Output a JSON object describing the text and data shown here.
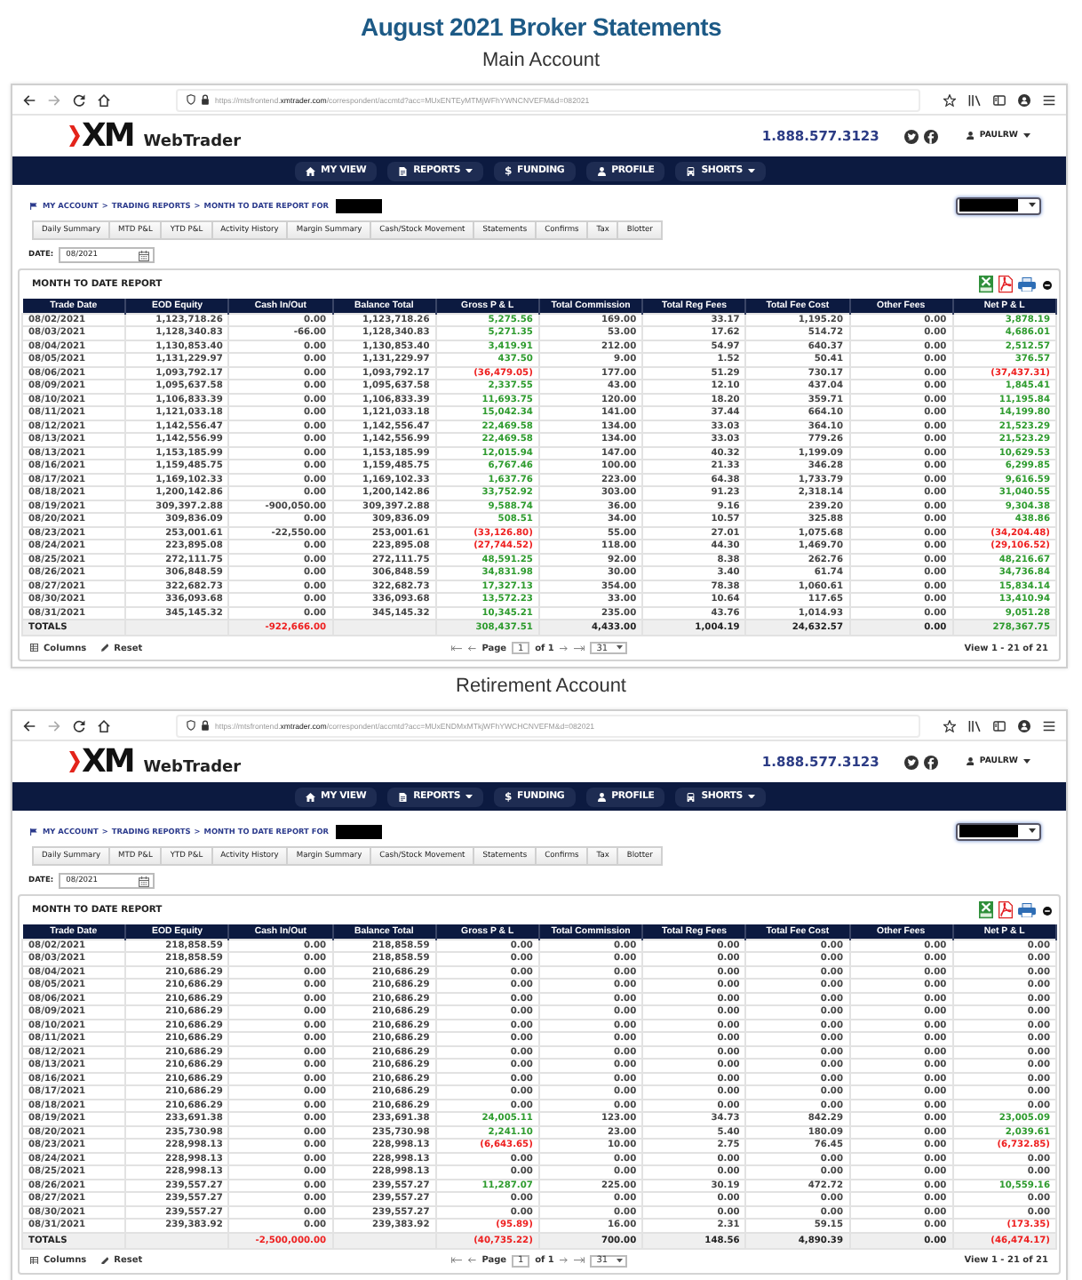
{
  "title": "August 2021 Broker Statements",
  "accounts": [
    {
      "heading": "Main Account",
      "browser": {
        "url": {
          "prefix": "https://mtsfrontend.",
          "domain": "xmtrader.com",
          "path": "/correspondent/accmtd?acc=MUxENTEyMTMjWFhYWNCNVEFM&d=082021"
        }
      },
      "header": {
        "logo": "XM",
        "product": "WebTrader",
        "phone": "1.888.577.3123",
        "user": "PAULRW"
      },
      "nav": [
        {
          "label": "MY VIEW",
          "dropdown": false
        },
        {
          "label": "REPORTS",
          "dropdown": true
        },
        {
          "label": "FUNDING",
          "glyph": "$",
          "dropdown": false
        },
        {
          "label": "PROFILE",
          "dropdown": false
        },
        {
          "label": "SHORTS",
          "dropdown": true
        }
      ],
      "breadcrumb": [
        {
          "label": "MY ACCOUNT",
          "separator": ">"
        },
        {
          "label": "TRADING REPORTS",
          "separator": ">"
        },
        {
          "label": "MONTH TO DATE REPORT FOR"
        }
      ],
      "tabs": [
        "Daily Summary",
        "MTD P&L",
        "YTD P&L",
        "Activity History",
        "Margin Summary",
        "Cash/Stock Movement",
        "Statements",
        "Confirms",
        "Tax",
        "Blotter"
      ],
      "date": {
        "label": "DATE:",
        "value": "08/2021"
      },
      "report": {
        "title": "MONTH TO DATE REPORT",
        "table": {
          "columns": [
            {
              "label": "Trade Date",
              "kind": "date"
            },
            {
              "label": "EOD Equity",
              "kind": "amount"
            },
            {
              "label": "Cash In/Out",
              "kind": "amount"
            },
            {
              "label": "Balance Total",
              "kind": "amount"
            },
            {
              "label": "Gross P & L",
              "kind": "pl"
            },
            {
              "label": "Total Commission",
              "kind": "amount"
            },
            {
              "label": "Total Reg Fees",
              "kind": "amount"
            },
            {
              "label": "Total Fee Cost",
              "kind": "amount"
            },
            {
              "label": "Other Fees",
              "kind": "amount"
            },
            {
              "label": "Net P & L",
              "kind": "pl"
            }
          ],
          "rows": [
            {
              "cells": [
                "08/02/2021",
                "1,123,718.26",
                "0.00",
                "1,123,718.26",
                "5,275.56",
                "169.00",
                "33.17",
                "1,195.20",
                "0.00",
                "3,878.19"
              ],
              "color": "#2e9b2e"
            },
            {
              "cells": [
                "08/03/2021",
                "1,128,340.83",
                "-66.00",
                "1,128,340.83",
                "5,271.35",
                "53.00",
                "17.62",
                "514.72",
                "0.00",
                "4,686.01"
              ],
              "color": "#2e9b2e"
            },
            {
              "cells": [
                "08/04/2021",
                "1,130,853.40",
                "0.00",
                "1,130,853.40",
                "3,419.91",
                "212.00",
                "54.97",
                "640.37",
                "0.00",
                "2,512.57"
              ],
              "color": "#2e9b2e"
            },
            {
              "cells": [
                "08/05/2021",
                "1,131,229.97",
                "0.00",
                "1,131,229.97",
                "437.50",
                "9.00",
                "1.52",
                "50.41",
                "0.00",
                "376.57"
              ],
              "color": "#2e9b2e"
            },
            {
              "cells": [
                "08/06/2021",
                "1,093,792.17",
                "0.00",
                "1,093,792.17",
                "(36,479.05)",
                "177.00",
                "51.29",
                "730.17",
                "0.00",
                "(37,437.31)"
              ],
              "color": "#ee2020"
            },
            {
              "cells": [
                "08/09/2021",
                "1,095,637.58",
                "0.00",
                "1,095,637.58",
                "2,337.55",
                "43.00",
                "12.10",
                "437.04",
                "0.00",
                "1,845.41"
              ],
              "color": "#2e9b2e"
            },
            {
              "cells": [
                "08/10/2021",
                "1,106,833.39",
                "0.00",
                "1,106,833.39",
                "11,693.75",
                "120.00",
                "18.20",
                "359.71",
                "0.00",
                "11,195.84"
              ],
              "color": "#2e9b2e"
            },
            {
              "cells": [
                "08/11/2021",
                "1,121,033.18",
                "0.00",
                "1,121,033.18",
                "15,042.34",
                "141.00",
                "37.44",
                "664.10",
                "0.00",
                "14,199.80"
              ],
              "color": "#2e9b2e"
            },
            {
              "cells": [
                "08/12/2021",
                "1,142,556.47",
                "0.00",
                "1,142,556.47",
                "22,469.58",
                "134.00",
                "33.03",
                "364.10",
                "0.00",
                "21,523.29"
              ],
              "color": "#2e9b2e"
            },
            {
              "cells": [
                "08/13/2021",
                "1,142,556.99",
                "0.00",
                "1,142,556.99",
                "22,469.58",
                "134.00",
                "33.03",
                "779.26",
                "0.00",
                "21,523.29"
              ],
              "color": "#2e9b2e"
            },
            {
              "cells": [
                "08/13/2021",
                "1,153,185.99",
                "0.00",
                "1,153,185.99",
                "12,015.94",
                "147.00",
                "40.32",
                "1,199.09",
                "0.00",
                "10,629.53"
              ],
              "color": "#2e9b2e"
            },
            {
              "cells": [
                "08/16/2021",
                "1,159,485.75",
                "0.00",
                "1,159,485.75",
                "6,767.46",
                "100.00",
                "21.33",
                "346.28",
                "0.00",
                "6,299.85"
              ],
              "color": "#2e9b2e"
            },
            {
              "cells": [
                "08/17/2021",
                "1,169,102.33",
                "0.00",
                "1,169,102.33",
                "1,637.76",
                "223.00",
                "64.38",
                "1,733.79",
                "0.00",
                "9,616.59"
              ],
              "color": "#2e9b2e"
            },
            {
              "cells": [
                "08/18/2021",
                "1,200,142.86",
                "0.00",
                "1,200,142.86",
                "33,752.92",
                "303.00",
                "91.23",
                "2,318.14",
                "0.00",
                "31,040.55"
              ],
              "color": "#2e9b2e"
            },
            {
              "cells": [
                "08/19/2021",
                "309,397.2.88",
                "-900,050.00",
                "309,397.2.88",
                "9,588.74",
                "36.00",
                "9.16",
                "239.20",
                "0.00",
                "9,304.38"
              ],
              "color": "#2e9b2e"
            },
            {
              "cells": [
                "08/20/2021",
                "309,836.09",
                "0.00",
                "309,836.09",
                "508.51",
                "34.00",
                "10.57",
                "325.88",
                "0.00",
                "438.86"
              ],
              "color": "#2e9b2e"
            },
            {
              "cells": [
                "08/23/2021",
                "253,001.61",
                "-22,550.00",
                "253,001.61",
                "(33,126.80)",
                "55.00",
                "27.01",
                "1,075.68",
                "0.00",
                "(34,204.48)"
              ],
              "color": "#ee2020"
            },
            {
              "cells": [
                "08/24/2021",
                "223,895.08",
                "0.00",
                "223,895.08",
                "(27,744.52)",
                "118.00",
                "44.30",
                "1,469.70",
                "0.00",
                "(29,106.52)"
              ],
              "color": "#ee2020"
            },
            {
              "cells": [
                "08/25/2021",
                "272,111.75",
                "0.00",
                "272,111.75",
                "48,591.25",
                "92.00",
                "8.38",
                "262.76",
                "0.00",
                "48,216.67"
              ],
              "color": "#2e9b2e"
            },
            {
              "cells": [
                "08/26/2021",
                "306,848.59",
                "0.00",
                "306,848.59",
                "34,831.98",
                "30.00",
                "3.40",
                "61.74",
                "0.00",
                "34,736.84"
              ],
              "color": "#2e9b2e"
            },
            {
              "cells": [
                "08/27/2021",
                "322,682.73",
                "0.00",
                "322,682.73",
                "17,327.13",
                "354.00",
                "78.38",
                "1,060.61",
                "0.00",
                "15,834.14"
              ],
              "color": "#2e9b2e"
            },
            {
              "cells": [
                "08/30/2021",
                "336,093.68",
                "0.00",
                "336,093.68",
                "13,572.23",
                "33.00",
                "10.64",
                "117.65",
                "0.00",
                "13,410.94"
              ],
              "color": "#2e9b2e"
            },
            {
              "cells": [
                "08/31/2021",
                "345,145.32",
                "0.00",
                "345,145.32",
                "10,345.21",
                "235.00",
                "43.76",
                "1,014.93",
                "0.00",
                "9,051.28"
              ],
              "color": "#2e9b2e"
            }
          ],
          "totals": {
            "label": "TOTALS",
            "cells": [
              null,
              {
                "text": "-922,666.00",
                "color": "#ee2020"
              },
              null,
              {
                "text": "308,437.51",
                "color": "#2e9b2e"
              },
              {
                "text": "4,433.00",
                "color": "#222222"
              },
              {
                "text": "1,004.19",
                "color": "#222222"
              },
              {
                "text": "24,632.57",
                "color": "#222222"
              },
              {
                "text": "0.00",
                "color": "#222222"
              },
              {
                "text": "278,367.75",
                "color": "#2e9b2e"
              }
            ]
          }
        },
        "footer": {
          "columns_label": "Columns",
          "reset_label": "Reset",
          "page_label": "Page",
          "page": "1",
          "of_label": "of 1",
          "page_size": "31",
          "summary": "View 1 - 21 of 21"
        }
      }
    },
    {
      "heading": "Retirement Account",
      "browser": {
        "url": {
          "prefix": "https://mtsfrontend.",
          "domain": "xmtrader.com",
          "path": "/correspondent/accmtd?acc=MUxENDMxMTkjWFhYWCHCNVEFM&d=082021"
        }
      },
      "header": {
        "logo": "XM",
        "product": "WebTrader",
        "phone": "1.888.577.3123",
        "user": "PAULRW"
      },
      "nav": [
        {
          "label": "MY VIEW",
          "dropdown": false
        },
        {
          "label": "REPORTS",
          "dropdown": true
        },
        {
          "label": "FUNDING",
          "glyph": "$",
          "dropdown": false
        },
        {
          "label": "PROFILE",
          "dropdown": false
        },
        {
          "label": "SHORTS",
          "dropdown": true
        }
      ],
      "breadcrumb": [
        {
          "label": "MY ACCOUNT",
          "separator": ">"
        },
        {
          "label": "TRADING REPORTS",
          "separator": ">"
        },
        {
          "label": "MONTH TO DATE REPORT FOR"
        }
      ],
      "tabs": [
        "Daily Summary",
        "MTD P&L",
        "YTD P&L",
        "Activity History",
        "Margin Summary",
        "Cash/Stock Movement",
        "Statements",
        "Confirms",
        "Tax",
        "Blotter"
      ],
      "date": {
        "label": "DATE:",
        "value": "08/2021"
      },
      "report": {
        "title": "MONTH TO DATE REPORT",
        "table": {
          "columns": [
            {
              "label": "Trade Date",
              "kind": "date"
            },
            {
              "label": "EOD Equity",
              "kind": "amount"
            },
            {
              "label": "Cash In/Out",
              "kind": "amount"
            },
            {
              "label": "Balance Total",
              "kind": "amount"
            },
            {
              "label": "Gross P & L",
              "kind": "pl"
            },
            {
              "label": "Total Commission",
              "kind": "amount"
            },
            {
              "label": "Total Reg Fees",
              "kind": "amount"
            },
            {
              "label": "Total Fee Cost",
              "kind": "amount"
            },
            {
              "label": "Other Fees",
              "kind": "amount"
            },
            {
              "label": "Net P & L",
              "kind": "pl"
            }
          ],
          "rows": [
            {
              "cells": [
                "08/02/2021",
                "218,858.59",
                "0.00",
                "218,858.59",
                "0.00",
                "0.00",
                "0.00",
                "0.00",
                "0.00",
                "0.00"
              ],
              "color": "#444444"
            },
            {
              "cells": [
                "08/03/2021",
                "218,858.59",
                "0.00",
                "218,858.59",
                "0.00",
                "0.00",
                "0.00",
                "0.00",
                "0.00",
                "0.00"
              ],
              "color": "#444444"
            },
            {
              "cells": [
                "08/04/2021",
                "210,686.29",
                "0.00",
                "210,686.29",
                "0.00",
                "0.00",
                "0.00",
                "0.00",
                "0.00",
                "0.00"
              ],
              "color": "#444444"
            },
            {
              "cells": [
                "08/05/2021",
                "210,686.29",
                "0.00",
                "210,686.29",
                "0.00",
                "0.00",
                "0.00",
                "0.00",
                "0.00",
                "0.00"
              ],
              "color": "#444444"
            },
            {
              "cells": [
                "08/06/2021",
                "210,686.29",
                "0.00",
                "210,686.29",
                "0.00",
                "0.00",
                "0.00",
                "0.00",
                "0.00",
                "0.00"
              ],
              "color": "#444444"
            },
            {
              "cells": [
                "08/09/2021",
                "210,686.29",
                "0.00",
                "210,686.29",
                "0.00",
                "0.00",
                "0.00",
                "0.00",
                "0.00",
                "0.00"
              ],
              "color": "#444444"
            },
            {
              "cells": [
                "08/10/2021",
                "210,686.29",
                "0.00",
                "210,686.29",
                "0.00",
                "0.00",
                "0.00",
                "0.00",
                "0.00",
                "0.00"
              ],
              "color": "#444444"
            },
            {
              "cells": [
                "08/11/2021",
                "210,686.29",
                "0.00",
                "210,686.29",
                "0.00",
                "0.00",
                "0.00",
                "0.00",
                "0.00",
                "0.00"
              ],
              "color": "#444444"
            },
            {
              "cells": [
                "08/12/2021",
                "210,686.29",
                "0.00",
                "210,686.29",
                "0.00",
                "0.00",
                "0.00",
                "0.00",
                "0.00",
                "0.00"
              ],
              "color": "#444444"
            },
            {
              "cells": [
                "08/13/2021",
                "210,686.29",
                "0.00",
                "210,686.29",
                "0.00",
                "0.00",
                "0.00",
                "0.00",
                "0.00",
                "0.00"
              ],
              "color": "#444444"
            },
            {
              "cells": [
                "08/16/2021",
                "210,686.29",
                "0.00",
                "210,686.29",
                "0.00",
                "0.00",
                "0.00",
                "0.00",
                "0.00",
                "0.00"
              ],
              "color": "#444444"
            },
            {
              "cells": [
                "08/17/2021",
                "210,686.29",
                "0.00",
                "210,686.29",
                "0.00",
                "0.00",
                "0.00",
                "0.00",
                "0.00",
                "0.00"
              ],
              "color": "#444444"
            },
            {
              "cells": [
                "08/18/2021",
                "210,686.29",
                "0.00",
                "210,686.29",
                "0.00",
                "0.00",
                "0.00",
                "0.00",
                "0.00",
                "0.00"
              ],
              "color": "#444444"
            },
            {
              "cells": [
                "08/19/2021",
                "233,691.38",
                "0.00",
                "233,691.38",
                "24,005.11",
                "123.00",
                "34.73",
                "842.29",
                "0.00",
                "23,005.09"
              ],
              "color": "#2e9b2e"
            },
            {
              "cells": [
                "08/20/2021",
                "235,730.98",
                "0.00",
                "235,730.98",
                "2,241.10",
                "23.00",
                "5.40",
                "180.09",
                "0.00",
                "2,039.61"
              ],
              "color": "#2e9b2e"
            },
            {
              "cells": [
                "08/23/2021",
                "228,998.13",
                "0.00",
                "228,998.13",
                "(6,643.65)",
                "10.00",
                "2.75",
                "76.45",
                "0.00",
                "(6,732.85)"
              ],
              "color": "#ee2020"
            },
            {
              "cells": [
                "08/24/2021",
                "228,998.13",
                "0.00",
                "228,998.13",
                "0.00",
                "0.00",
                "0.00",
                "0.00",
                "0.00",
                "0.00"
              ],
              "color": "#444444"
            },
            {
              "cells": [
                "08/25/2021",
                "228,998.13",
                "0.00",
                "228,998.13",
                "0.00",
                "0.00",
                "0.00",
                "0.00",
                "0.00",
                "0.00"
              ],
              "color": "#444444"
            },
            {
              "cells": [
                "08/26/2021",
                "239,557.27",
                "0.00",
                "239,557.27",
                "11,287.07",
                "225.00",
                "30.19",
                "472.72",
                "0.00",
                "10,559.16"
              ],
              "color": "#2e9b2e"
            },
            {
              "cells": [
                "08/27/2021",
                "239,557.27",
                "0.00",
                "239,557.27",
                "0.00",
                "0.00",
                "0.00",
                "0.00",
                "0.00",
                "0.00"
              ],
              "color": "#444444"
            },
            {
              "cells": [
                "08/30/2021",
                "239,557.27",
                "0.00",
                "239,557.27",
                "0.00",
                "0.00",
                "0.00",
                "0.00",
                "0.00",
                "0.00"
              ],
              "color": "#444444"
            },
            {
              "cells": [
                "08/31/2021",
                "239,383.92",
                "0.00",
                "239,383.92",
                "(95.89)",
                "16.00",
                "2.31",
                "59.15",
                "0.00",
                "(173.35)"
              ],
              "color": "#ee2020"
            }
          ],
          "totals": {
            "label": "TOTALS",
            "cells": [
              null,
              {
                "text": "-2,500,000.00",
                "color": "#ee2020"
              },
              null,
              {
                "text": "(40,735.22)",
                "color": "#ee2020"
              },
              {
                "text": "700.00",
                "color": "#222222"
              },
              {
                "text": "148.56",
                "color": "#222222"
              },
              {
                "text": "4,890.39",
                "color": "#222222"
              },
              {
                "text": "0.00",
                "color": "#222222"
              },
              {
                "text": "(46,474.17)",
                "color": "#ee2020"
              }
            ]
          }
        },
        "footer": {
          "columns_label": "Columns",
          "reset_label": "Reset",
          "page_label": "Page",
          "page": "1",
          "of_label": "of 1",
          "page_size": "31",
          "summary": "View 1 - 21 of 21"
        }
      }
    }
  ]
}
